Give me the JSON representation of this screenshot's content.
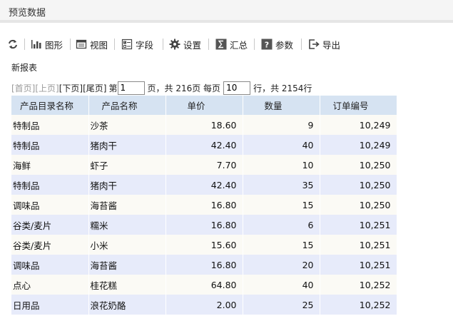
{
  "window": {
    "title": "预览数据"
  },
  "toolbar": {
    "refresh_icon": "refresh-icon",
    "chart": "图形",
    "view": "视图",
    "fields": "字段",
    "settings": "设置",
    "summary": "汇总",
    "params": "参数",
    "export": "导出"
  },
  "report": {
    "title": "新报表"
  },
  "pager": {
    "first": "[首页]",
    "prev": "[上页]",
    "next": "[下页]",
    "last": "[尾页]",
    "page_prefix": "第",
    "current_page": "1",
    "page_suffix": "页，共 216页 每页",
    "page_size": "10",
    "rows_suffix": "行，共 2154行"
  },
  "table": {
    "columns": [
      "产品目录名称",
      "产品名称",
      "单价",
      "数量",
      "订单编号"
    ],
    "rows": [
      [
        "特制品",
        "沙茶",
        "18.60",
        "9",
        "10,249"
      ],
      [
        "特制品",
        "猪肉干",
        "42.40",
        "40",
        "10,249"
      ],
      [
        "海鲜",
        "虾子",
        "7.70",
        "10",
        "10,250"
      ],
      [
        "特制品",
        "猪肉干",
        "42.40",
        "35",
        "10,250"
      ],
      [
        "调味品",
        "海苔酱",
        "16.80",
        "15",
        "10,250"
      ],
      [
        "谷类/麦片",
        "糯米",
        "16.80",
        "6",
        "10,251"
      ],
      [
        "谷类/麦片",
        "小米",
        "15.60",
        "15",
        "10,251"
      ],
      [
        "调味品",
        "海苔酱",
        "16.80",
        "20",
        "10,251"
      ],
      [
        "点心",
        "桂花糕",
        "64.80",
        "40",
        "10,252"
      ],
      [
        "日用品",
        "浪花奶酪",
        "2.00",
        "25",
        "10,252"
      ]
    ]
  }
}
